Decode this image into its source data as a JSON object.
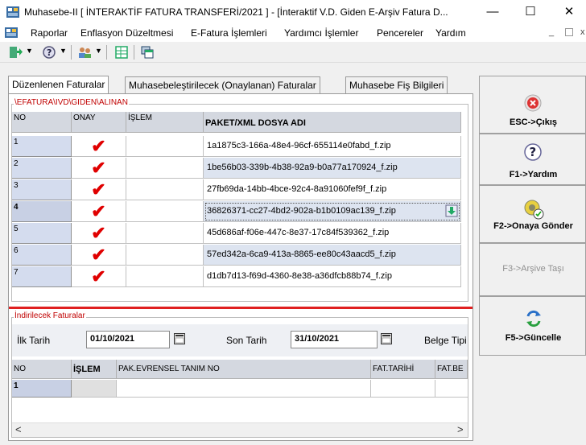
{
  "window": {
    "title": "Muhasebe-II  [ İNTERAKTİF FATURA TRANSFERİ/2021 ] - [İnteraktif V.D. Giden E-Arşiv Fatura D...",
    "minimize": "—",
    "maximize": "☐",
    "close": "✕"
  },
  "menu": {
    "items": [
      "Raporlar",
      "Enflasyon Düzeltmesi",
      "E-Fatura İşlemleri",
      "Yardımcı İşlemler",
      "Pencereler",
      "Yardım"
    ],
    "mdi_min": "_",
    "mdi_restore": "ｪ",
    "mdi_close": "x"
  },
  "tabs": [
    "Düzenlenen Faturalar",
    "Muhasebeleştirilecek (Onaylanan) Faturalar",
    "Muhasebe Fiş Bilgileri"
  ],
  "grid1": {
    "caption": "\\EFATURA\\IVD\\GIDEN\\ALINAN",
    "headers": {
      "no": "NO",
      "onay": "ONAY",
      "islem": "İŞLEM",
      "file": "PAKET/XML DOSYA ADI"
    },
    "rows": [
      {
        "no": "1",
        "file": "1a1875c3-166a-48e4-96cf-655114e0fabd_f.zip",
        "checked": true
      },
      {
        "no": "2",
        "file": "1be56b03-339b-4b38-92a9-b0a77a170924_f.zip",
        "checked": true
      },
      {
        "no": "3",
        "file": "27fb69da-14bb-4bce-92c4-8a91060fef9f_f.zip",
        "checked": true
      },
      {
        "no": "4",
        "file": "36826371-cc27-4bd2-902a-b1b0109ac139_f.zip",
        "checked": true
      },
      {
        "no": "5",
        "file": "45d686af-f06e-447c-8e37-17c84f539362_f.zip",
        "checked": true
      },
      {
        "no": "6",
        "file": "57ed342a-6ca9-413a-8865-ee80c43aacd5_f.zip",
        "checked": true
      },
      {
        "no": "7",
        "file": "d1db7d13-f69d-4360-8e38-a36dfcb88b74_f.zip",
        "checked": true
      }
    ],
    "check_glyph": "✔"
  },
  "grid2": {
    "caption": "İndirilecek Faturalar",
    "ilk_tarih_label": "İlk Tarih",
    "ilk_tarih_value": "01/10/2021",
    "son_tarih_label": "Son Tarih",
    "son_tarih_value": "31/10/2021",
    "belge_tipi_label": "Belge Tipi",
    "headers": {
      "no": "NO",
      "islem": "İŞLEM",
      "pak": "PAK.EVRENSEL TANIM NO",
      "fat_tarihi": "FAT.TARİHİ",
      "fat_be": "FAT.BE"
    },
    "rows": [
      {
        "no": "1"
      }
    ],
    "scroll_left": "<",
    "scroll_right": ">"
  },
  "right_buttons": [
    {
      "label": "ESC->Çıkış",
      "icon": "close-circle-icon",
      "enabled": true
    },
    {
      "label": "F1->Yardım",
      "icon": "help-icon",
      "enabled": true
    },
    {
      "label": "F2->Onaya Gönder",
      "icon": "send-approval-icon",
      "enabled": true
    },
    {
      "label": "F3->Arşive Taşı",
      "icon": "",
      "enabled": false
    },
    {
      "label": "F5->Güncelle",
      "icon": "refresh-icon",
      "enabled": true
    }
  ],
  "colors": {
    "caption_red": "#c00000",
    "check_red": "#e00000",
    "row_alt": "#dde4f0",
    "divider_red": "#e02020"
  }
}
